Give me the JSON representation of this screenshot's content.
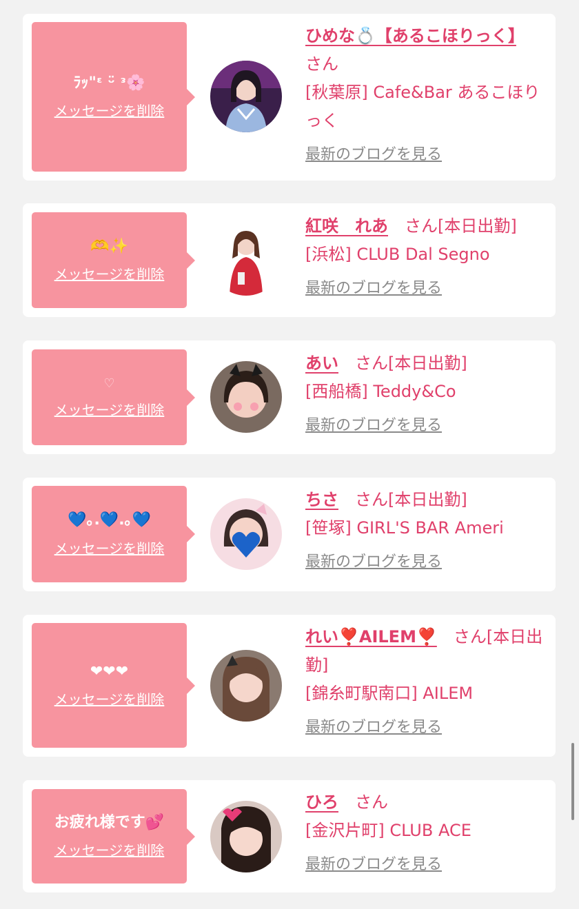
{
  "delete_label": "メッセージを削除",
  "honorific": "さん",
  "blog_link": "最新のブログを見る",
  "colors": {
    "background": "#f2f2f2",
    "card": "#ffffff",
    "bubble": "#f7949f",
    "accent": "#e0406b",
    "link_gray": "#8a8a8a"
  },
  "entries": [
    {
      "message": "ﾗｯ\"ᵋ ᵕ̈ ᵌ🌸",
      "name": "ひめな💍【あるこほりっく】",
      "status": "",
      "store": "[秋葉原] Cafe&Bar あるこほりっく",
      "avatar_icon": "girl-photo-icon"
    },
    {
      "message": "🫶✨",
      "name": "紅咲　れあ",
      "status": "[本日出勤]",
      "store": "[浜松] CLUB Dal Segno",
      "avatar_icon": "girl-photo-icon"
    },
    {
      "message": "♡",
      "name": "あい",
      "status": "[本日出勤]",
      "store": "[西船橋] Teddy&Co",
      "avatar_icon": "girl-photo-icon"
    },
    {
      "message": "💙｡.💙.｡💙",
      "name": "ちさ",
      "status": "[本日出勤]",
      "store": "[笹塚] GIRL'S BAR Ameri",
      "avatar_icon": "girl-photo-icon"
    },
    {
      "message": "❤︎❤︎❤︎",
      "name": "れい❣️AILEM❣️",
      "status": "[本日出勤]",
      "store": "[錦糸町駅南口] AILEM",
      "avatar_icon": "girl-photo-icon"
    },
    {
      "message": "お疲れ様です💕",
      "name": "ひろ",
      "status": "",
      "store": "[金沢片町] CLUB ACE",
      "avatar_icon": "girl-photo-icon"
    }
  ]
}
